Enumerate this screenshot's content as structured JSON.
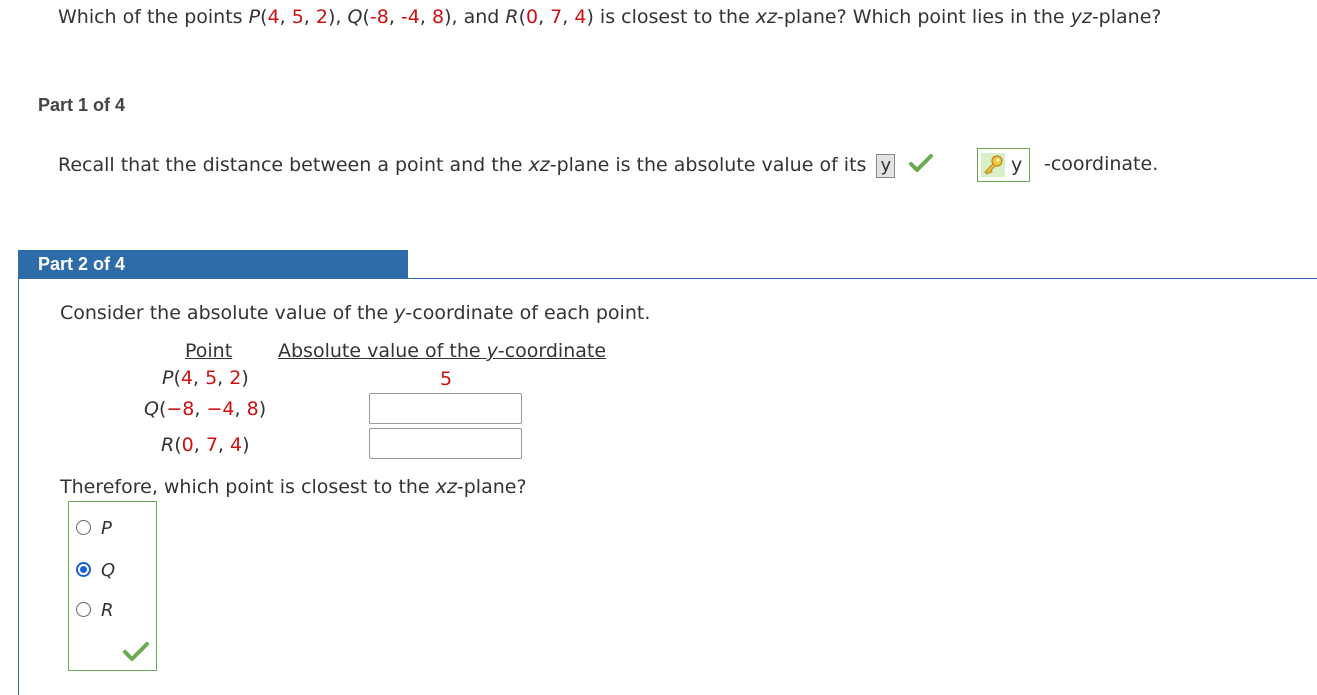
{
  "question": {
    "p1": "Which of the points ",
    "P_label": "P",
    "P_coords": [
      "4",
      "5",
      "2"
    ],
    "and_Q": ", ",
    "Q_label": "Q",
    "Q_coords": [
      "-8",
      "-4",
      "8"
    ],
    "and_R": ", and ",
    "R_label": "R",
    "R_coords": [
      "0",
      "7",
      "4"
    ],
    "p2": " is closest to the ",
    "plane1": "xz",
    "p3": "-plane? Which point lies in the ",
    "plane2": "yz",
    "p4": "-plane?"
  },
  "part1": {
    "title": "Part 1 of 4",
    "recall_a": "Recall that the distance between a point and the ",
    "recall_plane": "xz",
    "recall_b": "-plane is the absolute value of its ",
    "entered_answer": "y",
    "key_answer": "y",
    "suffix": "-coordinate."
  },
  "part2": {
    "title": "Part 2 of 4",
    "consider_a": "Consider the absolute value of the ",
    "consider_var": "y",
    "consider_b": "-coordinate of each point.",
    "col_point": "Point",
    "col_abs_a": "Absolute value of the ",
    "col_abs_var": "y",
    "col_abs_b": "-coordinate",
    "rows": [
      {
        "label": "P",
        "coords": [
          "4",
          "5",
          "2"
        ],
        "value": "5"
      },
      {
        "label": "Q",
        "coords": [
          "−8",
          "−4",
          "8"
        ],
        "value": ""
      },
      {
        "label": "R",
        "coords": [
          "0",
          "7",
          "4"
        ],
        "value": ""
      }
    ],
    "therefore_a": "Therefore, which point is closest to the ",
    "therefore_plane": "xz",
    "therefore_b": "-plane?",
    "choices": [
      "P",
      "Q",
      "R"
    ],
    "selected": "Q"
  },
  "colors": {
    "accent": "#2d6ca8",
    "number_red": "#cc1111",
    "correct_green": "#6aab4f",
    "radio_blue": "#1a5fd6"
  }
}
